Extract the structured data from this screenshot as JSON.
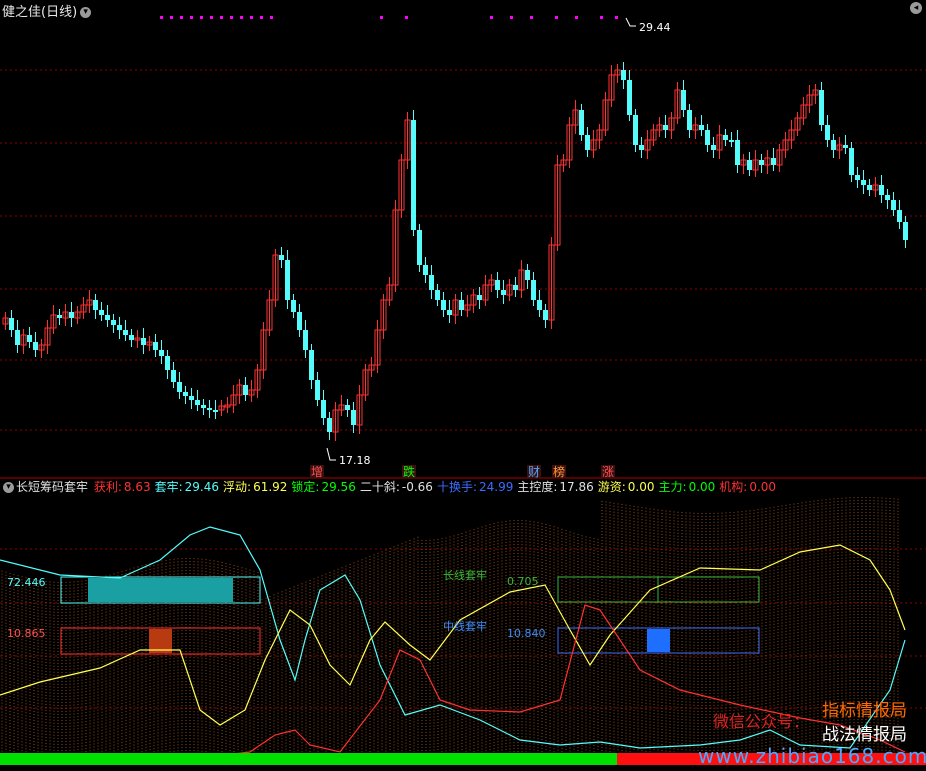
{
  "window": {
    "title": "健之佳(日线)",
    "dropdown_icon": "chevron-down-icon",
    "corner_icon": "settings-icon"
  },
  "main_chart": {
    "high_label": "29.44",
    "low_label": "17.18",
    "tags": [
      {
        "text": "增",
        "color": "#ff5050"
      },
      {
        "text": "跌",
        "color": "#00ff00"
      },
      {
        "text": "财",
        "color": "#4da6ff"
      },
      {
        "text": "榜",
        "color": "#ff9933"
      },
      {
        "text": "涨",
        "color": "#ff5050"
      }
    ],
    "colors": {
      "up": "#ff3232",
      "down": "#54fcfc",
      "grid": "#8b0000"
    }
  },
  "indicator": {
    "name": "长短筹码套牢",
    "fields": [
      {
        "label": "获利:",
        "value": "8.63",
        "color": "#ff3232"
      },
      {
        "label": "套牢:",
        "value": "29.46",
        "color": "#54fcfc"
      },
      {
        "label": "浮动:",
        "value": "61.92",
        "color": "#ffff54"
      },
      {
        "label": "锁定:",
        "value": "29.56",
        "color": "#00ff00"
      },
      {
        "label": "二十斜:",
        "value": "-0.66",
        "color": "#e0e0e0"
      },
      {
        "label": "十换手:",
        "value": "24.99",
        "color": "#3c6cff"
      },
      {
        "label": "主控度:",
        "value": "17.86",
        "color": "#e0e0e0"
      },
      {
        "label": "游资:",
        "value": "0.00",
        "color": "#ffff54"
      },
      {
        "label": "主力:",
        "value": "0.00",
        "color": "#00ff00"
      },
      {
        "label": "机构:",
        "value": "0.00",
        "color": "#ff3232"
      }
    ],
    "left_panel": {
      "top_value": "72.446",
      "bottom_value": "10.865"
    },
    "right_panel": {
      "long_label": "长线套牢",
      "long_value": "0.705",
      "mid_label": "中线套牢",
      "mid_value": "10.840"
    }
  },
  "watermark": {
    "wechat": "微信公众号：",
    "line1": "指标情报局",
    "line2": "战法情报局",
    "url": "www.zhibiao168.com"
  }
}
